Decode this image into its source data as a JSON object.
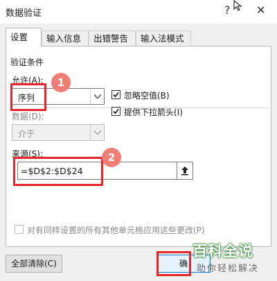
{
  "window": {
    "title": "数据验证",
    "help": "?",
    "close": "✕"
  },
  "tabs": [
    {
      "label": "设置",
      "active": true
    },
    {
      "label": "输入信息",
      "active": false
    },
    {
      "label": "出错警告",
      "active": false
    },
    {
      "label": "输入法模式",
      "active": false
    }
  ],
  "criteria": {
    "section_title": "验证条件",
    "allow_label": "允许(A):",
    "allow_value": "序列",
    "ignore_blank_label": "忽略空值(B)",
    "ignore_blank_checked": true,
    "dropdown_label": "提供下拉箭头(I)",
    "dropdown_checked": true,
    "data_label": "数据(D):",
    "data_value": "介于",
    "source_label": "来源(S):",
    "source_value": "=$D$2:$D$24",
    "apply_all_label": "对有同样设置的所有其他单元格应用这些更改(P)",
    "apply_all_checked": false
  },
  "footer": {
    "clear_all_label": "全部清除(C)",
    "ok_label": "确"
  },
  "annotations": {
    "badge1": "1",
    "badge2": "2"
  },
  "watermark": {
    "main": "百科全说",
    "sub": "助你轻松解决"
  },
  "colors": {
    "highlight": "#e8262a",
    "badge": "#ef7f76"
  }
}
